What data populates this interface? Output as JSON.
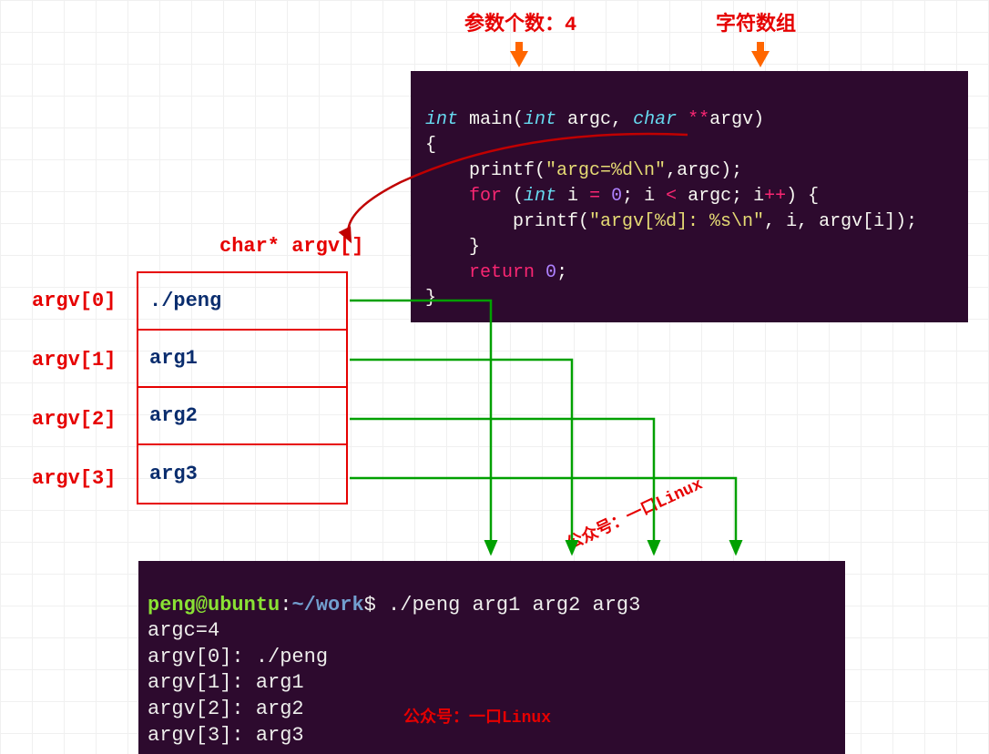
{
  "annotations": {
    "argc_label": "参数个数：4",
    "argv_label": "字符数组",
    "array_title": "char* argv[]"
  },
  "code": {
    "line1_int": "int",
    "line1_main": " main(",
    "line1_int2": "int",
    "line1_argc": " argc, ",
    "line1_char": "char",
    "line1_stars": " **",
    "line1_argv": "argv)",
    "line2": "{",
    "line3_printf": "    printf(",
    "line3_str": "\"argc=%d\\n\"",
    "line3_rest": ",argc);",
    "line4_for": "    for",
    "line4_paren": " (",
    "line4_int": "int",
    "line4_i": " i ",
    "line4_eq": "=",
    "line4_sp": " ",
    "line4_zero": "0",
    "line4_semi": "; i ",
    "line4_lt": "<",
    "line4_rest": " argc; i",
    "line4_pp": "++",
    "line4_end": ") {",
    "line5_printf": "        printf(",
    "line5_str": "\"argv[%d]: %s\\n\"",
    "line5_rest": ", i, argv[i]);",
    "line6": "    }",
    "line7_return": "    return",
    "line7_sp": " ",
    "line7_zero": "0",
    "line7_semi": ";",
    "line8": "}"
  },
  "array": {
    "labels": [
      "argv[0]",
      "argv[1]",
      "argv[2]",
      "argv[3]"
    ],
    "values": [
      "./peng",
      "arg1",
      "arg2",
      "arg3"
    ]
  },
  "terminal": {
    "prompt_user": "peng@ubuntu",
    "prompt_colon": ":",
    "prompt_path": "~/work",
    "prompt_dollar": "$",
    "cmd": " ./peng arg1 arg2 arg3",
    "out1": "argc=4",
    "out2": "argv[0]: ./peng",
    "out3": "argv[1]: arg1",
    "out4": "argv[2]: arg2",
    "out5": "argv[3]: arg3"
  },
  "watermark": "公众号：一口Linux"
}
